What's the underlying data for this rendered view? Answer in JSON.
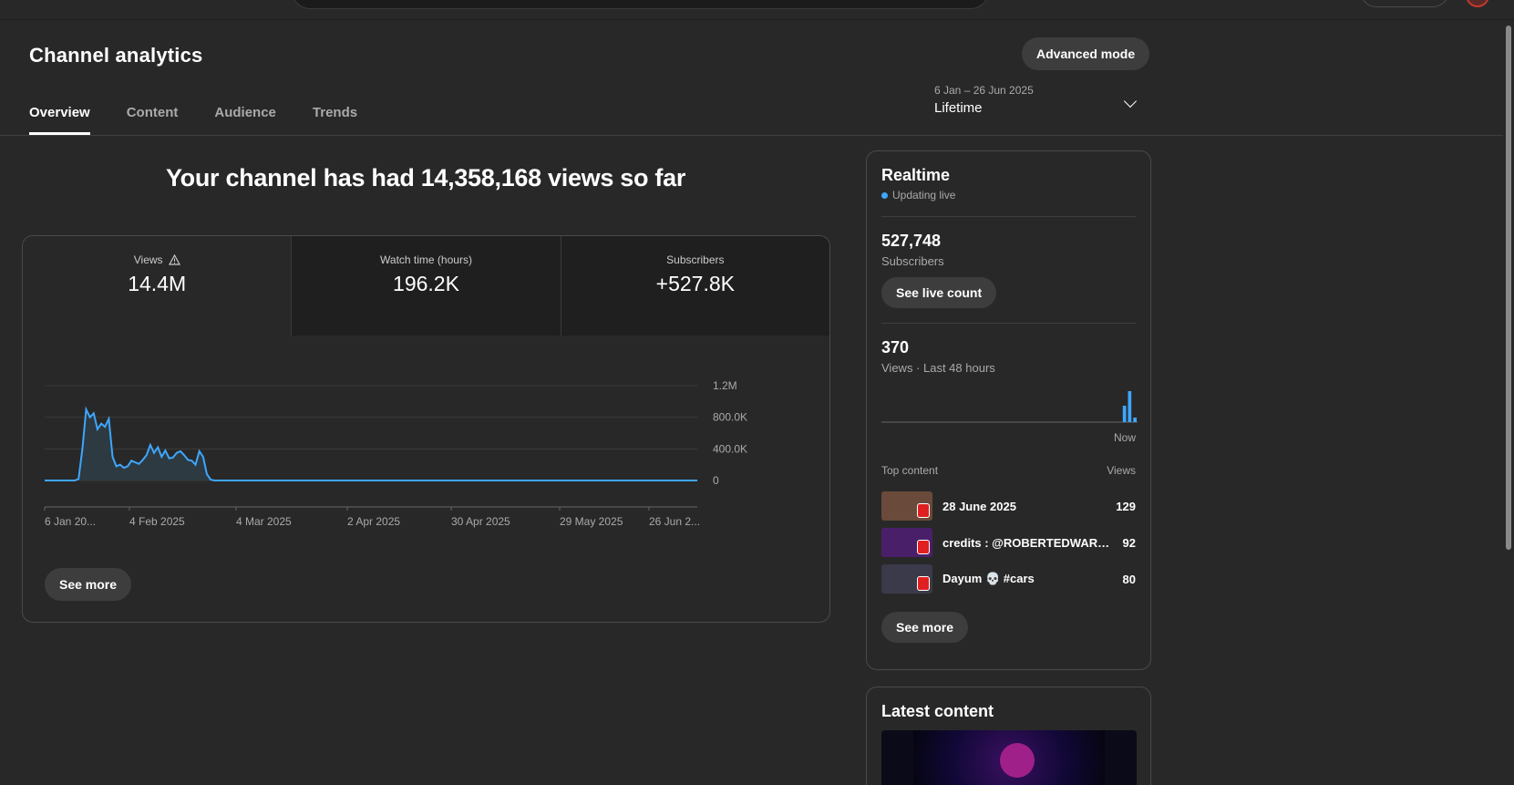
{
  "page": {
    "title": "Channel analytics",
    "advanced_mode_label": "Advanced mode"
  },
  "tabs": [
    {
      "label": "Overview",
      "active": true
    },
    {
      "label": "Content",
      "active": false
    },
    {
      "label": "Audience",
      "active": false
    },
    {
      "label": "Trends",
      "active": false
    }
  ],
  "date_picker": {
    "range": "6 Jan – 26 Jun 2025",
    "period": "Lifetime"
  },
  "headline": "Your channel has had 14,358,168 views so far",
  "metrics": [
    {
      "label": "Views",
      "value": "14.4M",
      "icon": "warning-icon"
    },
    {
      "label": "Watch time (hours)",
      "value": "196.2K"
    },
    {
      "label": "Subscribers",
      "value": "+527.8K"
    }
  ],
  "overview_see_more": "See more",
  "chart_data": {
    "type": "line",
    "y_tick_labels": [
      "1.2M",
      "800.0K",
      "400.0K",
      "0"
    ],
    "ylim": [
      0,
      1200000
    ],
    "x_tick_labels": [
      "6 Jan 20...",
      "4 Feb 2025",
      "4 Mar 2025",
      "2 Apr 2025",
      "30 Apr 2025",
      "29 May 2025",
      "26 Jun 2..."
    ],
    "series": [
      {
        "color": "#3ea6ff",
        "values": [
          0,
          0,
          0,
          0,
          0,
          0,
          0,
          0,
          0,
          20000,
          400000,
          900000,
          800000,
          850000,
          650000,
          720000,
          680000,
          780000,
          300000,
          180000,
          200000,
          160000,
          180000,
          250000,
          230000,
          210000,
          260000,
          320000,
          450000,
          350000,
          420000,
          300000,
          380000,
          280000,
          290000,
          350000,
          370000,
          320000,
          260000,
          250000,
          200000,
          370000,
          300000,
          80000,
          10000,
          0,
          0,
          0,
          0,
          0,
          0,
          0,
          0,
          0,
          0,
          0,
          0,
          0,
          0,
          0,
          0,
          0,
          0,
          0,
          0,
          0,
          0,
          0,
          0,
          0,
          0,
          0,
          0,
          0,
          0,
          0,
          0,
          0,
          0,
          0,
          0,
          0,
          0,
          0,
          0,
          0,
          0,
          0,
          0,
          0,
          0,
          0,
          0,
          0,
          0,
          0,
          0,
          0,
          0,
          0,
          0,
          0,
          0,
          0,
          0,
          0,
          0,
          0,
          0,
          0,
          0,
          0,
          0,
          0,
          0,
          0,
          0,
          0,
          0,
          0,
          0,
          0,
          0,
          0,
          0,
          0,
          0,
          0,
          0,
          0,
          0,
          0,
          0,
          0,
          0,
          0,
          0,
          0,
          0,
          0,
          0,
          0,
          0,
          0,
          0,
          0,
          0,
          0,
          0,
          0,
          0,
          0,
          0,
          0,
          0,
          0,
          0,
          0,
          0,
          0,
          0,
          0,
          0,
          0,
          0,
          0,
          0,
          0,
          0,
          0,
          0,
          0,
          0,
          0
        ]
      }
    ],
    "grid": true,
    "color_fill": "#2e3f47"
  },
  "realtime": {
    "title": "Realtime",
    "status": "Updating live",
    "subscribers_value": "527,748",
    "subscribers_label": "Subscribers",
    "see_live_count": "See live count",
    "views_value": "370",
    "views_label": "Views · Last 48 hours",
    "now_label": "Now",
    "spark_values": [
      0,
      0,
      0,
      0,
      0,
      0,
      0,
      0,
      0,
      0,
      0,
      0,
      0,
      0,
      0,
      0,
      0,
      0,
      0,
      0,
      0,
      0,
      0,
      0,
      0,
      0,
      0,
      0,
      0,
      0,
      0,
      0,
      0,
      0,
      0,
      0,
      0,
      0,
      0,
      0,
      0,
      0,
      0,
      0,
      0,
      0,
      18,
      34,
      5
    ],
    "top_content_label": "Top content",
    "views_col_label": "Views",
    "items": [
      {
        "title": "28 June 2025",
        "views": "129",
        "thumb_color": "#6a4a3a"
      },
      {
        "title": "credits : @ROBERTEDWARD...",
        "views": "92",
        "thumb_color": "#4a1f6a"
      },
      {
        "title": "Dayum 💀 #cars",
        "views": "80",
        "thumb_color": "#3a3a4a"
      }
    ],
    "see_more": "See more"
  },
  "latest": {
    "title": "Latest content"
  }
}
